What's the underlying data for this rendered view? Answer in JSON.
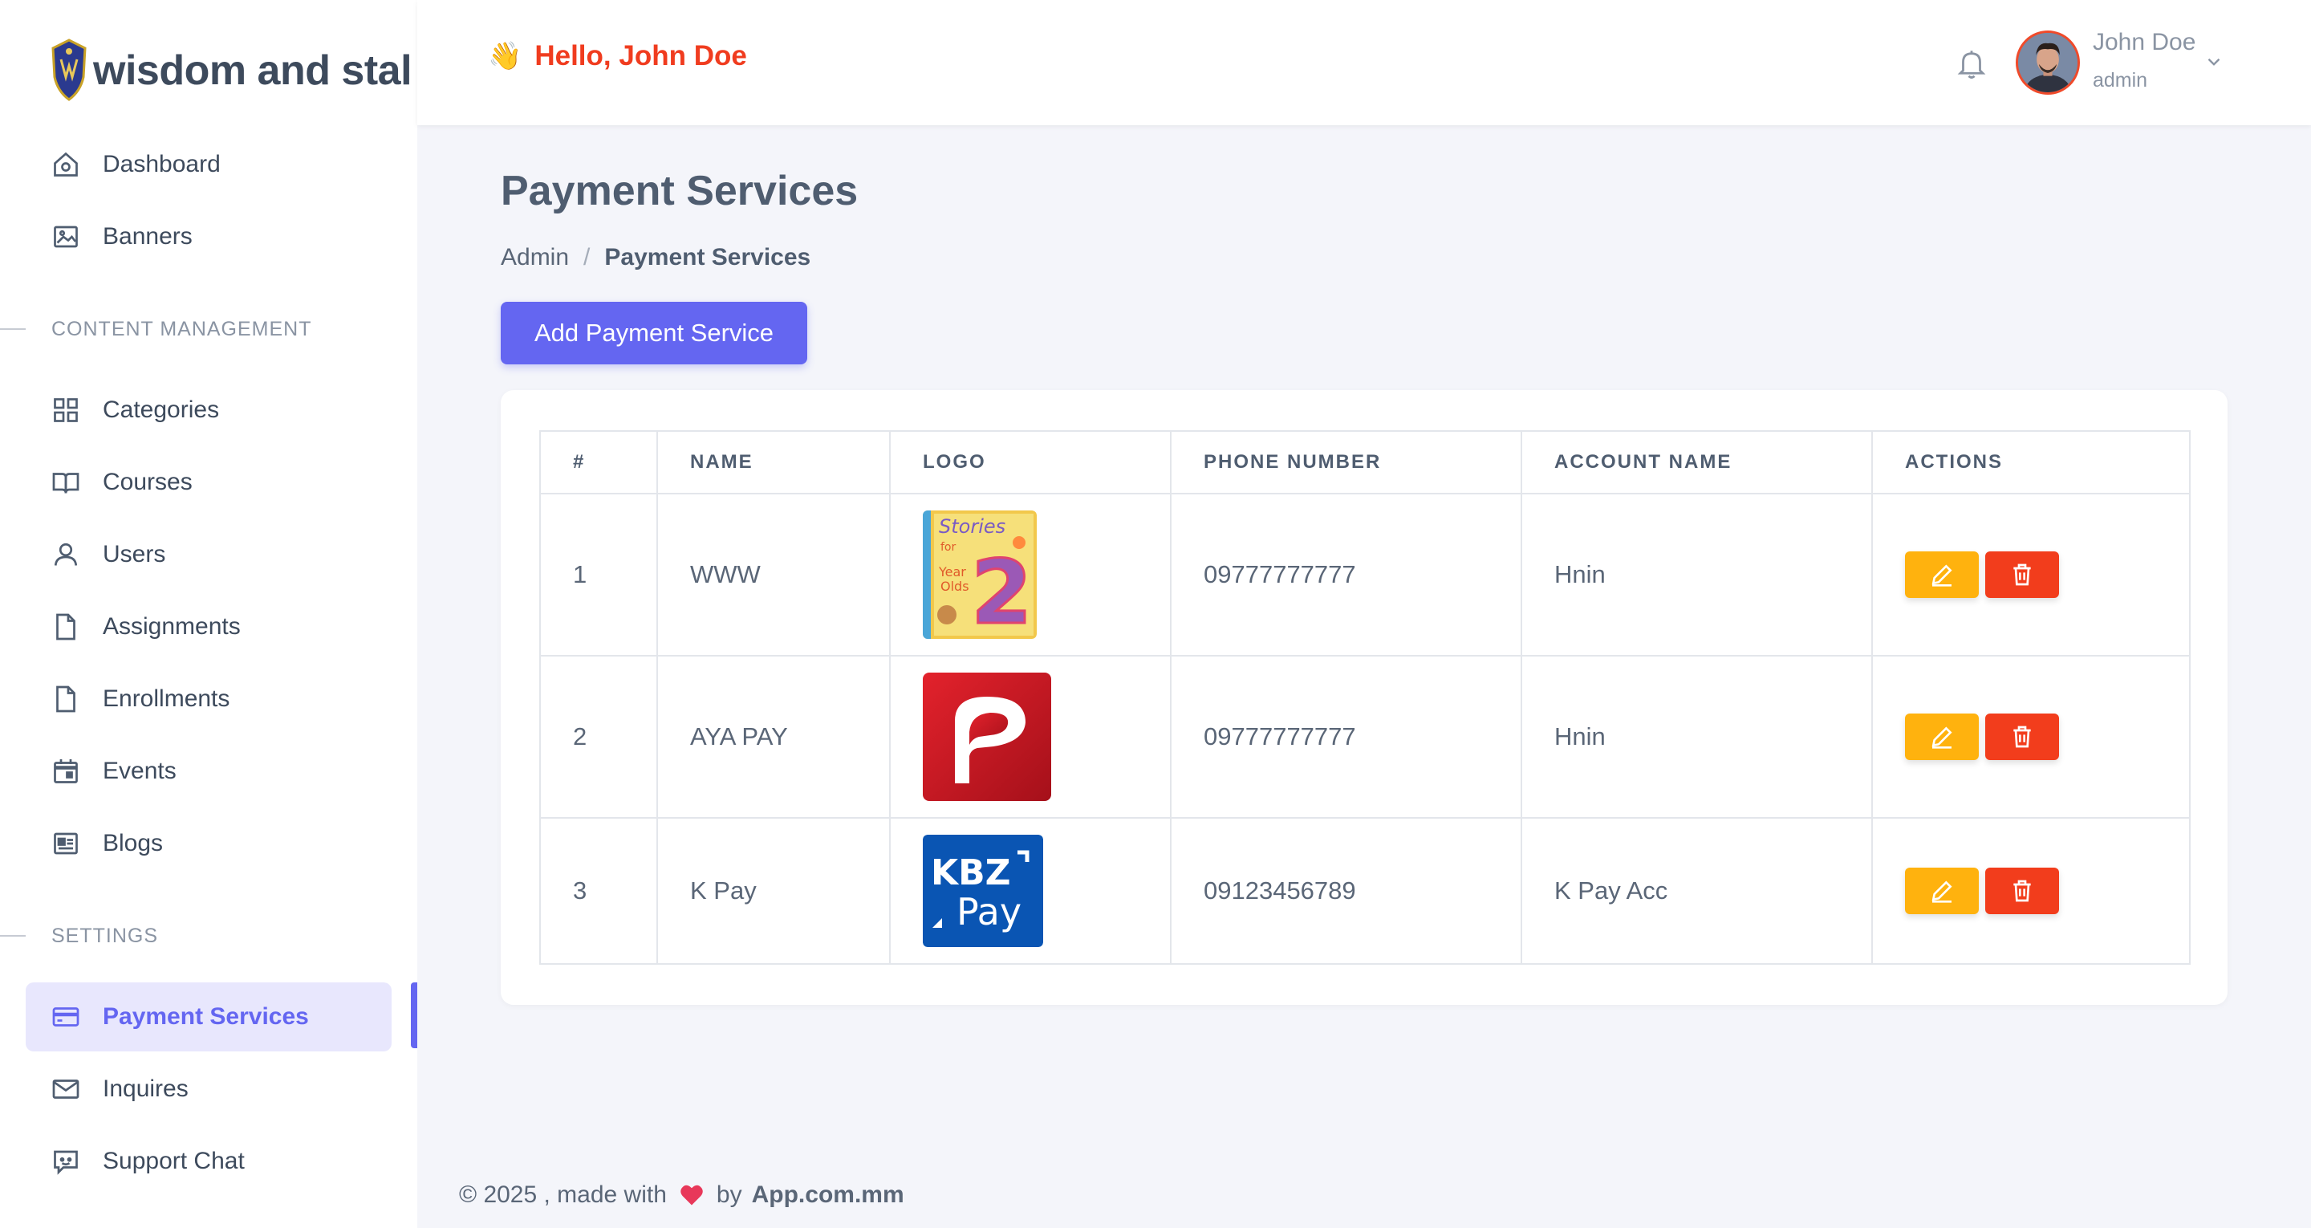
{
  "brand": {
    "name": "wisdom and stal"
  },
  "header": {
    "greeting_emoji": "👋",
    "greeting": "Hello, John Doe",
    "user_name": "John Doe",
    "user_role": "admin"
  },
  "sidebar": {
    "items_top": [
      {
        "label": "Dashboard",
        "icon": "home-icon"
      },
      {
        "label": "Banners",
        "icon": "image-icon"
      }
    ],
    "section_content": "CONTENT MANAGEMENT",
    "items_content": [
      {
        "label": "Categories",
        "icon": "grid-icon"
      },
      {
        "label": "Courses",
        "icon": "book-icon"
      },
      {
        "label": "Users",
        "icon": "user-icon"
      },
      {
        "label": "Assignments",
        "icon": "document-icon"
      },
      {
        "label": "Enrollments",
        "icon": "document-icon"
      },
      {
        "label": "Events",
        "icon": "calendar-icon"
      },
      {
        "label": "Blogs",
        "icon": "newspaper-icon"
      }
    ],
    "section_settings": "SETTINGS",
    "items_settings": [
      {
        "label": "Payment Services",
        "icon": "credit-card-icon",
        "active": true
      },
      {
        "label": "Inquires",
        "icon": "mail-icon"
      },
      {
        "label": "Support Chat",
        "icon": "chat-icon"
      }
    ]
  },
  "page": {
    "title": "Payment Services",
    "breadcrumb": [
      "Admin",
      "Payment Services"
    ],
    "breadcrumb_sep": "/",
    "add_button": "Add Payment Service"
  },
  "table": {
    "headers": [
      "#",
      "NAME",
      "LOGO",
      "PHONE NUMBER",
      "ACCOUNT NAME",
      "ACTIONS"
    ],
    "rows": [
      {
        "no": "1",
        "name": "WWW",
        "logo": "stories-book-logo",
        "phone": "09777777777",
        "account": "Hnin"
      },
      {
        "no": "2",
        "name": "AYA PAY",
        "logo": "aya-pay-logo",
        "phone": "09777777777",
        "account": "Hnin"
      },
      {
        "no": "3",
        "name": "K Pay",
        "logo": "kbz-pay-logo",
        "phone": "09123456789",
        "account": "K Pay Acc"
      }
    ]
  },
  "footer": {
    "prefix": "© 2025 , made with",
    "by": "by",
    "brand": "App.com.mm"
  },
  "colors": {
    "accent": "#6466f1",
    "greeting": "#f03c1f",
    "edit": "#ffb20e",
    "delete": "#f23d1c",
    "background": "#f4f5fa"
  }
}
